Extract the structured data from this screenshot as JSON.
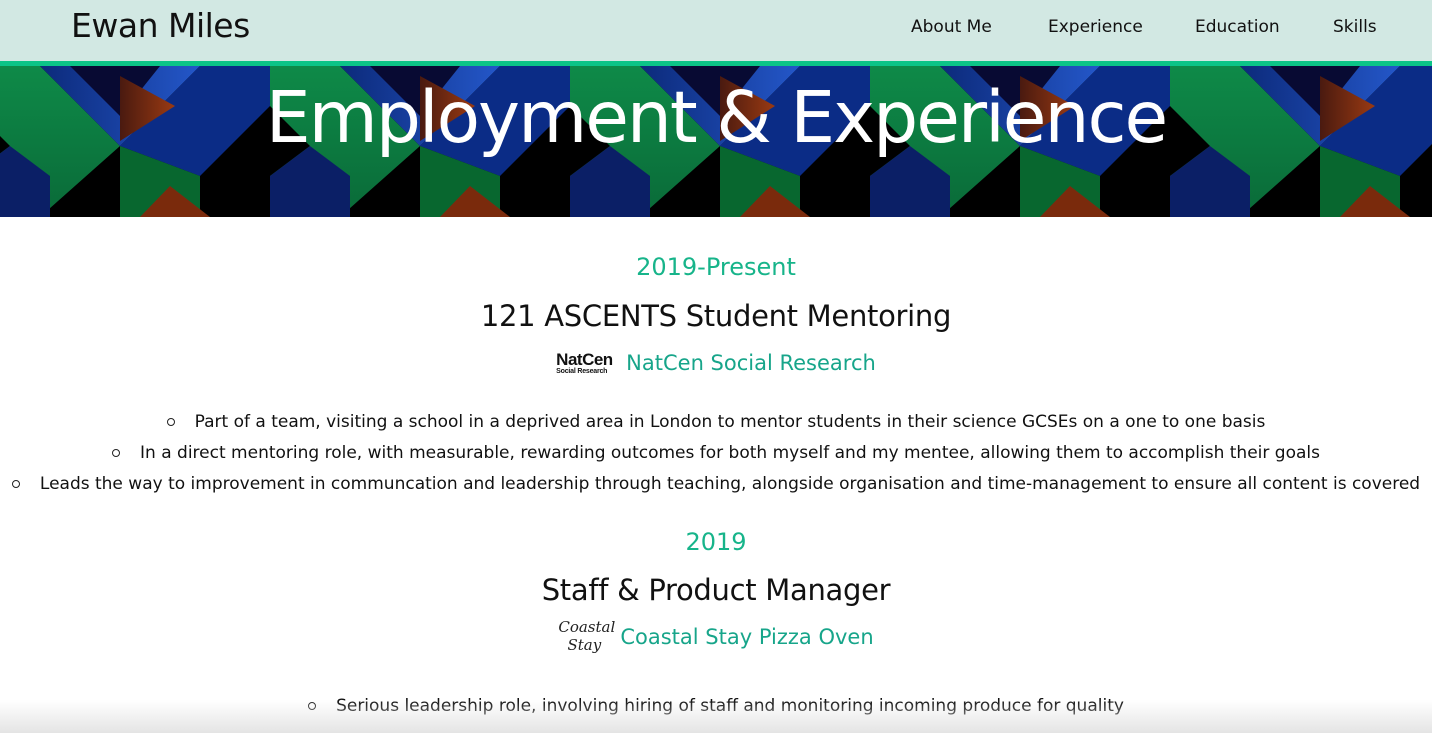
{
  "navbar": {
    "brand": "Ewan Miles",
    "links": [
      "About Me",
      "Experience",
      "Education",
      "Skills"
    ]
  },
  "hero": {
    "title": "Employment & Experience"
  },
  "jobs": [
    {
      "period": "2019-Present",
      "title": "121 ASCENTS Student Mentoring",
      "logo": {
        "line1": "NatCen",
        "line2": "Social Research"
      },
      "organization": "NatCen Social Research",
      "bullets": [
        "Part of a team, visiting a school in a deprived area in London to mentor students in their science GCSEs on a one to one basis",
        "In a direct mentoring role, with measurable, rewarding outcomes for both myself and my mentee, allowing them to accomplish their goals",
        "Leads the way to improvement in communcation and leadership through teaching, alongside organisation and time-management to ensure all content is covered"
      ]
    },
    {
      "period": "2019",
      "title": "Staff & Product Manager",
      "logo": {
        "line1": "Coastal",
        "line2": "Stay"
      },
      "organization": "Coastal Stay Pizza Oven",
      "bullets": [
        "Serious leadership role, involving hiring of staff and monitoring incoming produce for quality"
      ]
    }
  ],
  "colors": {
    "navbar_bg": "#d2e8e3",
    "accent": "#0cc487",
    "period_text": "#17b48a",
    "org_link": "#17a58a"
  }
}
